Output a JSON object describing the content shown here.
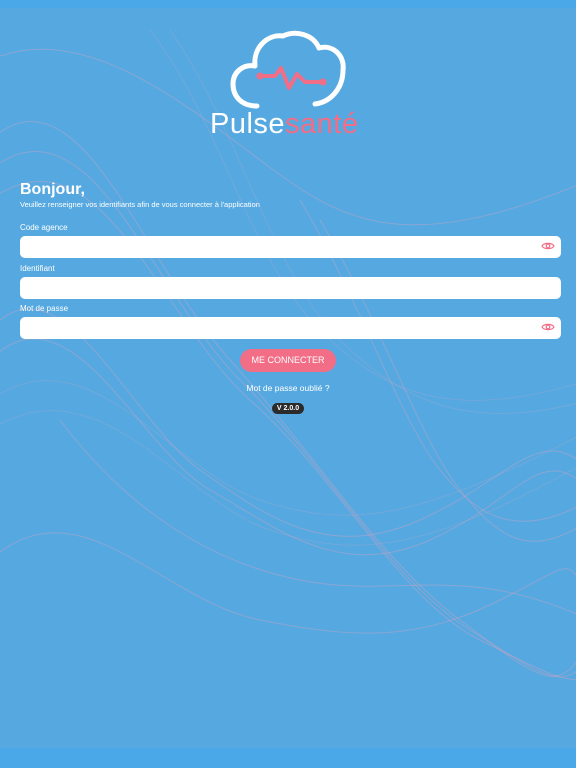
{
  "brand": {
    "name_part1": "Pulse",
    "name_part2": "santé",
    "accent_color": "#f26d86",
    "background_color": "#56a9e0"
  },
  "login": {
    "greeting": "Bonjour,",
    "subtitle": "Veuillez renseigner vos identifiants afin de vous connecter à l'application",
    "fields": [
      {
        "label": "Code agence",
        "value": "",
        "placeholder": "",
        "icon": "eye-icon"
      },
      {
        "label": "Identifiant",
        "value": "",
        "placeholder": ""
      },
      {
        "label": "Mot de passe",
        "value": "",
        "placeholder": "",
        "icon": "eye-icon"
      }
    ],
    "submit_label": "ME CONNECTER",
    "forgot_label": "Mot de passe oublié ?",
    "version": "V 2.0.0"
  }
}
